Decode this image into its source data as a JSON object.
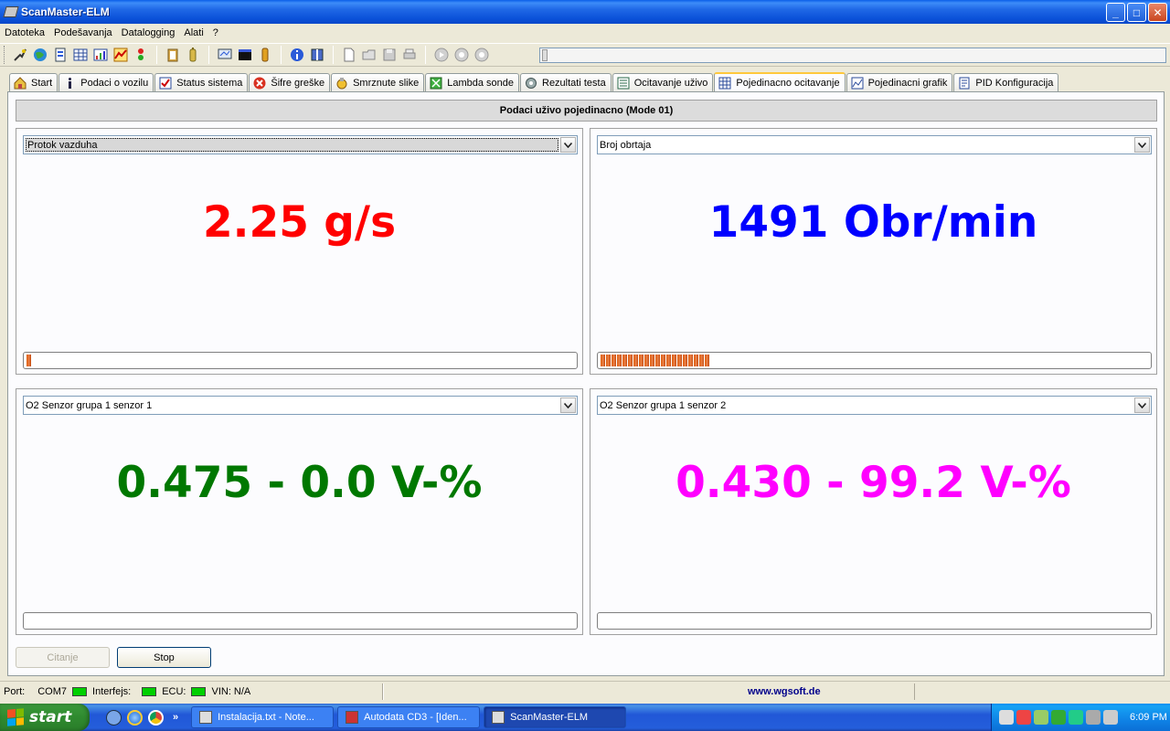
{
  "window": {
    "title": "ScanMaster-ELM",
    "controls": {
      "minimize": "_",
      "maximize": "□",
      "close": "✕"
    }
  },
  "menu": [
    "Datoteka",
    "Podešavanja",
    "Datalogging",
    "Alati",
    "?"
  ],
  "toolbar": {
    "group1": [
      "connect-icon",
      "globe-icon",
      "document-icon",
      "table-icon",
      "chart-icon",
      "graph-icon",
      "traffic-light-icon"
    ],
    "group2": [
      "clipboard-icon",
      "battery-icon"
    ],
    "group3": [
      "monitor-icon",
      "terminal-icon",
      "memory-icon"
    ],
    "group4": [
      "info-icon",
      "book-icon"
    ],
    "group5": [
      "new-file-icon",
      "open-icon",
      "save-icon",
      "print-icon"
    ],
    "group6": [
      "play-icon",
      "pause-icon",
      "stop-icon"
    ]
  },
  "tabs": [
    {
      "label": "Start",
      "icon": "home-icon",
      "active": false
    },
    {
      "label": "Podaci o vozilu",
      "icon": "info-icon",
      "active": false
    },
    {
      "label": "Status sistema",
      "icon": "checkbox-icon",
      "active": false
    },
    {
      "label": "Šifre greške",
      "icon": "error-icon",
      "active": false
    },
    {
      "label": "Smrznute slike",
      "icon": "freeze-icon",
      "active": false
    },
    {
      "label": "Lambda sonde",
      "icon": "lambda-icon",
      "active": false
    },
    {
      "label": "Rezultati testa",
      "icon": "gear-icon",
      "active": false
    },
    {
      "label": "Ocitavanje uživo",
      "icon": "list-icon",
      "active": false
    },
    {
      "label": "Pojedinacno ocitavanje",
      "icon": "grid-icon",
      "active": true
    },
    {
      "label": "Pojedinacni grafik",
      "icon": "graph-icon",
      "active": false
    },
    {
      "label": "PID Konfiguracija",
      "icon": "doc-icon",
      "active": false
    }
  ],
  "main": {
    "header": "Podaci uživo pojedinacno (Mode 01)",
    "panels": [
      {
        "select": "Protok vazduha",
        "reading": "2.25 g/s",
        "color": "#ff0000",
        "progress": 0.01,
        "focused": true
      },
      {
        "select": "Broj obrtaja",
        "reading": "1491 Obr/min",
        "color": "#0000ff",
        "progress": 0.2,
        "focused": false
      },
      {
        "select": "O2 Senzor grupa 1 senzor 1",
        "reading": "0.475 - 0.0 V-%",
        "color": "#007800",
        "progress": 0.0,
        "focused": false
      },
      {
        "select": "O2 Senzor grupa 1 senzor 2",
        "reading": "0.430 - 99.2 V-%",
        "color": "#ff00ff",
        "progress": 0.0,
        "focused": false
      }
    ],
    "buttons": {
      "read": "Citanje",
      "stop": "Stop"
    }
  },
  "statusbar": {
    "port_label": "Port:",
    "port_value": "COM7",
    "interface_label": "Interfejs:",
    "ecu_label": "ECU:",
    "vin": "VIN: N/A",
    "link": "www.wgsoft.de",
    "led_color": "#00d000"
  },
  "taskbar": {
    "start": "start",
    "tasks": [
      {
        "label": "Instalacija.txt - Note...",
        "active": false
      },
      {
        "label": "Autodata CD3 - [Iden...",
        "active": false
      },
      {
        "label": "ScanMaster-ELM",
        "active": true
      }
    ],
    "overflow": "»",
    "clock": "6:09 PM"
  }
}
